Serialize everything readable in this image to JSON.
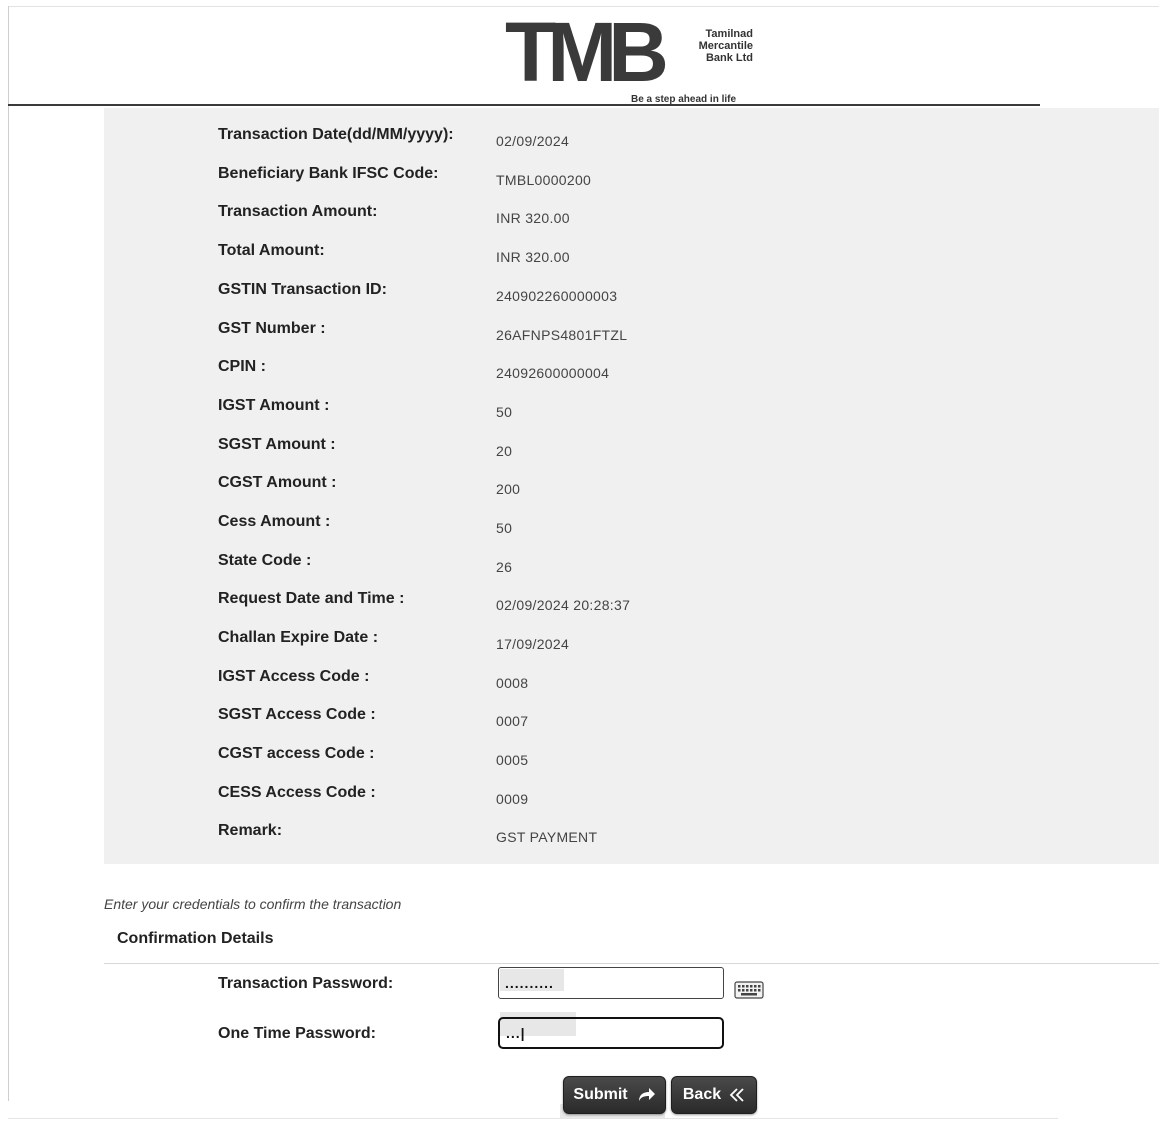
{
  "brand": {
    "logo_text": "TMB",
    "name_lines": [
      "Tamilnad",
      "Mercantile",
      "Bank Ltd"
    ],
    "tagline": "Be a step ahead in life"
  },
  "details": [
    {
      "label": "Transaction Date(dd/MM/yyyy):",
      "value": "02/09/2024"
    },
    {
      "label": "Beneficiary Bank IFSC Code:",
      "value": "TMBL0000200"
    },
    {
      "label": "Transaction Amount:",
      "value": "INR 320.00"
    },
    {
      "label": "Total Amount:",
      "value": "INR 320.00"
    },
    {
      "label": "GSTIN Transaction ID:",
      "value": "240902260000003"
    },
    {
      "label": "GST Number :",
      "value": "26AFNPS4801FTZL"
    },
    {
      "label": "CPIN :",
      "value": "24092600000004"
    },
    {
      "label": "IGST Amount :",
      "value": "50"
    },
    {
      "label": "SGST Amount :",
      "value": "20"
    },
    {
      "label": "CGST Amount :",
      "value": "200"
    },
    {
      "label": "Cess Amount :",
      "value": "50"
    },
    {
      "label": "State Code :",
      "value": "26"
    },
    {
      "label": "Request Date and Time :",
      "value": "02/09/2024 20:28:37"
    },
    {
      "label": "Challan Expire Date :",
      "value": "17/09/2024"
    },
    {
      "label": "IGST Access Code :",
      "value": "0008"
    },
    {
      "label": "SGST Access Code :",
      "value": "0007"
    },
    {
      "label": "CGST access Code :",
      "value": "0005"
    },
    {
      "label": "CESS Access Code :",
      "value": "0009"
    },
    {
      "label": "Remark:",
      "value": "GST PAYMENT"
    }
  ],
  "confirmation": {
    "instruction": "Enter your credentials to confirm the transaction",
    "title": "Confirmation Details",
    "transaction_password_label": "Transaction Password:",
    "transaction_password_value": "..........",
    "otp_label": "One Time Password:",
    "otp_value": "...|"
  },
  "buttons": {
    "submit": "Submit",
    "back": "Back"
  },
  "icons": {
    "keyboard": "keyboard-icon",
    "submit": "share-arrow-icon",
    "back": "double-chevron-left-icon"
  }
}
